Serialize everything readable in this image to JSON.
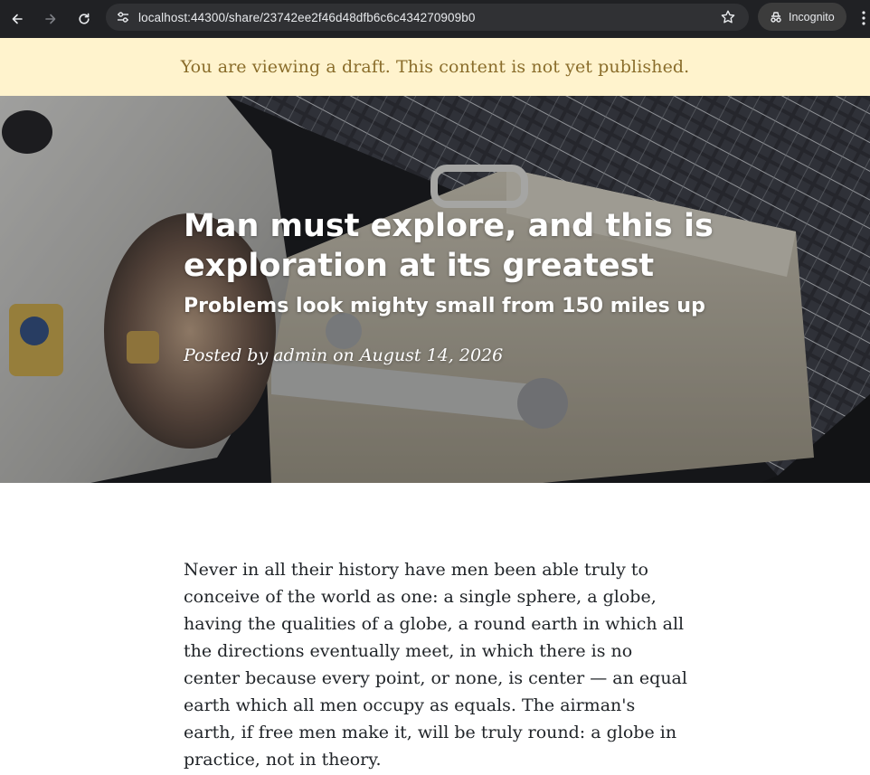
{
  "browser": {
    "url": "localhost:44300/share/23742ee2f46d48dfb6c6c434270909b0",
    "incognito_label": "Incognito",
    "icons": {
      "back": "arrow-left-icon",
      "forward": "arrow-right-icon",
      "reload": "reload-icon",
      "site_info": "tune-icon",
      "bookmark": "star-icon",
      "incognito": "incognito-icon",
      "menu": "kebab-menu-icon"
    }
  },
  "banner": {
    "text": "You are viewing a draft. This content is not yet published.",
    "background": "#fff3cd",
    "color": "#8a6d2b"
  },
  "hero": {
    "title": "Man must explore, and this is exploration at its greatest",
    "subtitle": "Problems look mighty small from 150 miles up",
    "meta_prefix": "Posted by ",
    "author": "admin",
    "meta_mid": " on ",
    "date": "August 14, 2026"
  },
  "article": {
    "paragraphs": [
      "Never in all their history have men been able truly to conceive of the world as one: a single sphere, a globe, having the qualities of a globe, a round earth in which all the directions eventually meet, in which there is no center because every point, or none, is center — an equal earth which all men occupy as equals. The airman's earth, if free men make it, will be truly round: a globe in practice, not in theory."
    ]
  }
}
